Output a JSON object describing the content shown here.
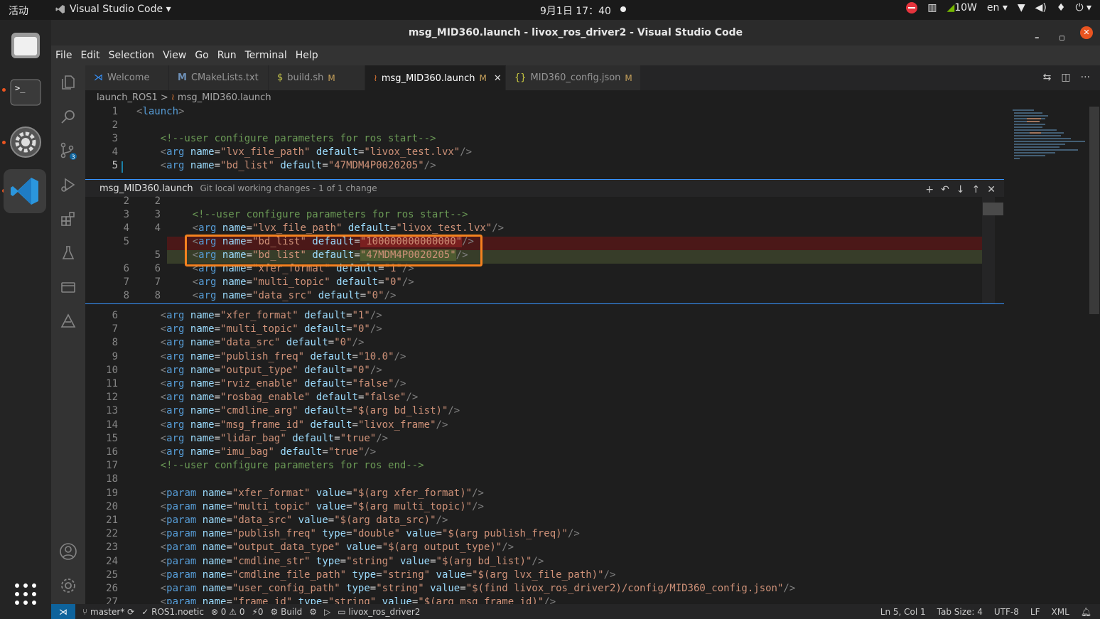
{
  "system": {
    "activities": "活动",
    "app_name": "Visual Studio Code ▾",
    "clock": "9月1日  17：40",
    "power": "10W",
    "lang": "en ▾"
  },
  "window": {
    "title": "msg_MID360.launch - livox_ros_driver2 - Visual Studio Code"
  },
  "menu": [
    "File",
    "Edit",
    "Selection",
    "View",
    "Go",
    "Run",
    "Terminal",
    "Help"
  ],
  "tabs": [
    {
      "label": "Welcome",
      "mod": ""
    },
    {
      "label": "CMakeLists.txt",
      "mod": ""
    },
    {
      "label": "build.sh",
      "mod": "M"
    },
    {
      "label": "msg_MID360.launch",
      "mod": "M"
    },
    {
      "label": "MID360_config.json",
      "mod": "M"
    }
  ],
  "breadcrumb": {
    "folder": "launch_ROS1",
    "file": "msg_MID360.launch"
  },
  "top_lines": [
    {
      "n": "1",
      "code": "<launch>"
    },
    {
      "n": "2",
      "code": ""
    },
    {
      "n": "3",
      "code": "    <!--user configure parameters for ros start-->"
    },
    {
      "n": "4",
      "code": "    <arg name=\"lvx_file_path\" default=\"livox_test.lvx\"/>"
    },
    {
      "n": "5",
      "code": "    <arg name=\"bd_list\" default=\"47MDM4P0020205\"/>"
    }
  ],
  "diff": {
    "filename": "msg_MID360.launch",
    "description": "Git local working changes - 1 of 1 change",
    "lines": [
      {
        "o": "2",
        "m": "2",
        "code": ""
      },
      {
        "o": "3",
        "m": "3",
        "code": "    <!--user configure parameters for ros start-->"
      },
      {
        "o": "4",
        "m": "4",
        "code": "    <arg name=\"lvx_file_path\" default=\"livox_test.lvx\"/>"
      },
      {
        "o": "5",
        "m": "",
        "code": "    <arg name=\"bd_list\" default=\"100000000000000\"/>"
      },
      {
        "o": "",
        "m": "5",
        "code": "    <arg name=\"bd_list\" default=\"47MDM4P0020205\"/>"
      },
      {
        "o": "6",
        "m": "6",
        "code": "    <arg name=\"xfer_format\" default=\"1\"/>"
      },
      {
        "o": "7",
        "m": "7",
        "code": "    <arg name=\"multi_topic\" default=\"0\"/>"
      },
      {
        "o": "8",
        "m": "8",
        "code": "    <arg name=\"data_src\" default=\"0\"/>"
      }
    ]
  },
  "bottom_lines": [
    {
      "n": "6",
      "code": "    <arg name=\"xfer_format\" default=\"1\"/>"
    },
    {
      "n": "7",
      "code": "    <arg name=\"multi_topic\" default=\"0\"/>"
    },
    {
      "n": "8",
      "code": "    <arg name=\"data_src\" default=\"0\"/>"
    },
    {
      "n": "9",
      "code": "    <arg name=\"publish_freq\" default=\"10.0\"/>"
    },
    {
      "n": "10",
      "code": "    <arg name=\"output_type\" default=\"0\"/>"
    },
    {
      "n": "11",
      "code": "    <arg name=\"rviz_enable\" default=\"false\"/>"
    },
    {
      "n": "12",
      "code": "    <arg name=\"rosbag_enable\" default=\"false\"/>"
    },
    {
      "n": "13",
      "code": "    <arg name=\"cmdline_arg\" default=\"$(arg bd_list)\"/>"
    },
    {
      "n": "14",
      "code": "    <arg name=\"msg_frame_id\" default=\"livox_frame\"/>"
    },
    {
      "n": "15",
      "code": "    <arg name=\"lidar_bag\" default=\"true\"/>"
    },
    {
      "n": "16",
      "code": "    <arg name=\"imu_bag\" default=\"true\"/>"
    },
    {
      "n": "17",
      "code": "    <!--user configure parameters for ros end-->"
    },
    {
      "n": "18",
      "code": ""
    },
    {
      "n": "19",
      "code": "    <param name=\"xfer_format\" value=\"$(arg xfer_format)\"/>"
    },
    {
      "n": "20",
      "code": "    <param name=\"multi_topic\" value=\"$(arg multi_topic)\"/>"
    },
    {
      "n": "21",
      "code": "    <param name=\"data_src\" value=\"$(arg data_src)\"/>"
    },
    {
      "n": "22",
      "code": "    <param name=\"publish_freq\" type=\"double\" value=\"$(arg publish_freq)\"/>"
    },
    {
      "n": "23",
      "code": "    <param name=\"output_data_type\" value=\"$(arg output_type)\"/>"
    },
    {
      "n": "24",
      "code": "    <param name=\"cmdline_str\" type=\"string\" value=\"$(arg bd_list)\"/>"
    },
    {
      "n": "25",
      "code": "    <param name=\"cmdline_file_path\" type=\"string\" value=\"$(arg lvx_file_path)\"/>"
    },
    {
      "n": "26",
      "code": "    <param name=\"user_config_path\" type=\"string\" value=\"$(find livox_ros_driver2)/config/MID360_config.json\"/>"
    },
    {
      "n": "27",
      "code": "    <param name=\"frame_id\" type=\"string\" value=\"$(arg msg_frame_id)\"/>"
    }
  ],
  "status": {
    "branch": "master*",
    "ros": "✓ ROS1.noetic",
    "problems": "⊗ 0 ⚠ 0",
    "ports": "⚡0",
    "build": "⚙ Build",
    "folder": "livox_ros_driver2",
    "position": "Ln 5, Col 1",
    "tabsize": "Tab Size: 4",
    "encoding": "UTF-8",
    "eol": "LF",
    "lang": "XML"
  }
}
